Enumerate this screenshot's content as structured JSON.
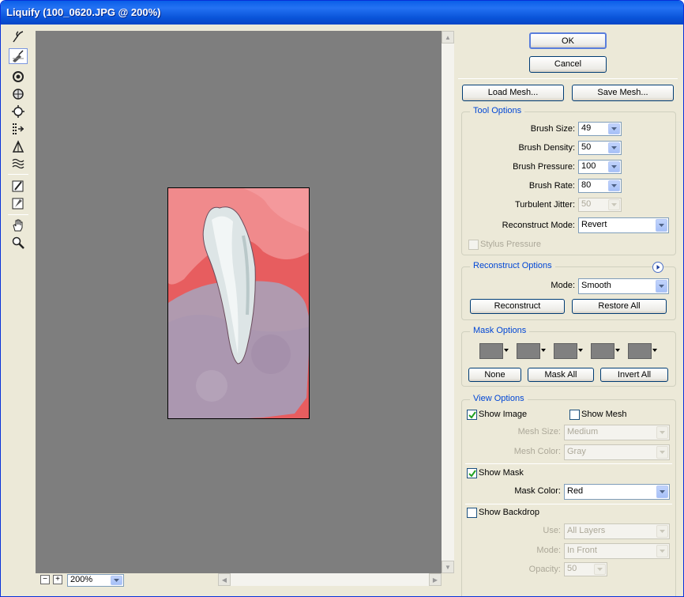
{
  "window": {
    "title": "Liquify (100_0620.JPG @ 200%)"
  },
  "tools": [
    "forward-warp",
    "reconstruct",
    "twirl",
    "pucker",
    "bloat",
    "push-left",
    "mirror",
    "turbulence",
    "freeze-mask",
    "thaw-mask",
    "hand",
    "zoom"
  ],
  "buttons": {
    "ok": "OK",
    "cancel": "Cancel",
    "load_mesh": "Load Mesh...",
    "save_mesh": "Save Mesh..."
  },
  "tool_options": {
    "title": "Tool Options",
    "brush_size": {
      "label": "Brush Size:",
      "value": "49"
    },
    "brush_density": {
      "label": "Brush Density:",
      "value": "50"
    },
    "brush_pressure": {
      "label": "Brush Pressure:",
      "value": "100"
    },
    "brush_rate": {
      "label": "Brush Rate:",
      "value": "80"
    },
    "turbulent_jitter": {
      "label": "Turbulent Jitter:",
      "value": "50"
    },
    "reconstruct_mode": {
      "label": "Reconstruct Mode:",
      "value": "Revert"
    },
    "stylus_pressure": "Stylus Pressure"
  },
  "reconstruct_options": {
    "title": "Reconstruct Options",
    "mode_label": "Mode:",
    "mode_value": "Smooth",
    "reconstruct": "Reconstruct",
    "restore_all": "Restore All"
  },
  "mask_options": {
    "title": "Mask Options",
    "none": "None",
    "mask_all": "Mask All",
    "invert_all": "Invert All"
  },
  "view_options": {
    "title": "View Options",
    "show_image": "Show Image",
    "show_image_checked": true,
    "show_mesh": "Show Mesh",
    "show_mesh_checked": false,
    "mesh_size": {
      "label": "Mesh Size:",
      "value": "Medium"
    },
    "mesh_color": {
      "label": "Mesh Color:",
      "value": "Gray"
    },
    "show_mask": "Show Mask",
    "show_mask_checked": true,
    "mask_color": {
      "label": "Mask Color:",
      "value": "Red"
    },
    "show_backdrop": "Show Backdrop",
    "show_backdrop_checked": false,
    "use": {
      "label": "Use:",
      "value": "All Layers"
    },
    "mode": {
      "label": "Mode:",
      "value": "In Front"
    },
    "opacity": {
      "label": "Opacity:",
      "value": "50"
    }
  },
  "zoom": {
    "value": "200%",
    "minus": "−",
    "plus": "+"
  },
  "colors": {
    "title_bar": "#0a5fe8",
    "canvas": "#7e7e7e",
    "mask": "#e8585a",
    "group_title": "#0046d5"
  }
}
